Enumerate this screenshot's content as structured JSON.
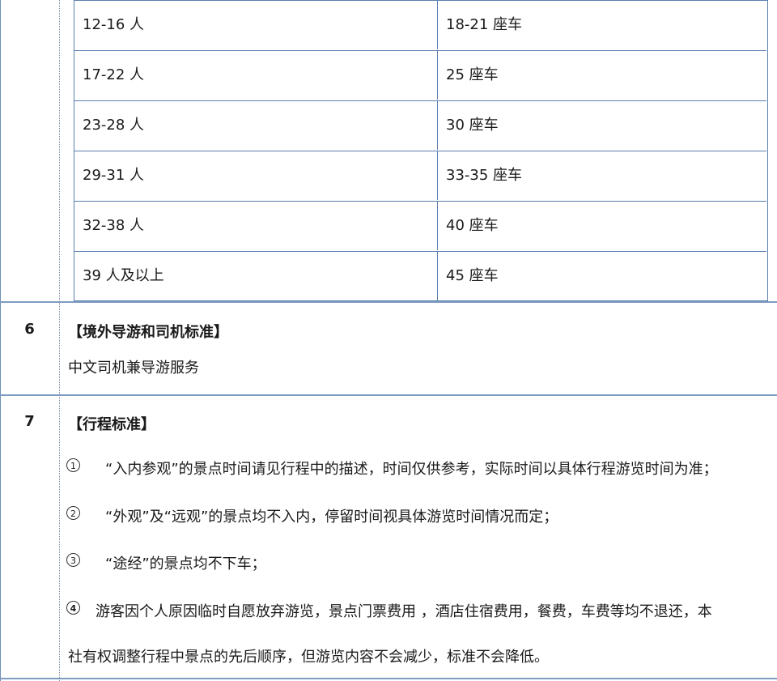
{
  "vehicle_table": {
    "rows": [
      {
        "people": "12-16 人",
        "vehicle": "18-21 座车"
      },
      {
        "people": "17-22 人",
        "vehicle": "25 座车"
      },
      {
        "people": "23-28 人",
        "vehicle": "30 座车"
      },
      {
        "people": "29-31 人",
        "vehicle": "33-35 座车"
      },
      {
        "people": "32-38 人",
        "vehicle": "40 座车"
      },
      {
        "people": "39 人及以上",
        "vehicle": "45 座车"
      }
    ]
  },
  "section6": {
    "number": "6",
    "title": "【境外导游和司机标准】",
    "text": "中文司机兼导游服务"
  },
  "section7": {
    "number": "7",
    "title": "【行程标准】",
    "items": [
      {
        "marker": "1",
        "text": "“入内参观”的景点时间请见行程中的描述，时间仅供参考，实际时间以具体行程游览时间为准；"
      },
      {
        "marker": "2",
        "text": "“外观”及“远观”的景点均不入内，停留时间视具体游览时间情况而定；"
      },
      {
        "marker": "3",
        "text": "“途经”的景点均不下车；"
      },
      {
        "marker": "4",
        "text": "游客因个人原因临时自愿放弃游览，景点门票费用 ，酒店住宿费用，餐费，车费等均不退还，本",
        "text_cont": "社有权调整行程中景点的先后顺序，但游览内容不会减少，标准不会降低。"
      }
    ]
  }
}
